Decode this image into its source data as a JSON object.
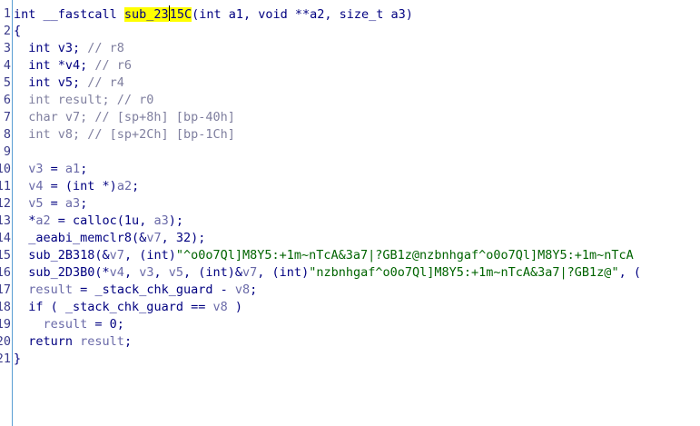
{
  "function_name": "sub_2315C",
  "lines": [
    {
      "num": "1",
      "tokens": [
        {
          "t": "int __fastcall ",
          "c": "plain"
        },
        {
          "t": "sub_23",
          "c": "hl"
        },
        {
          "caret": true
        },
        {
          "t": "15C",
          "c": "hl"
        },
        {
          "t": "(int a1, void **a2, size_t a3)",
          "c": "plain"
        }
      ]
    },
    {
      "num": "2",
      "tokens": [
        {
          "t": "{",
          "c": "plain"
        }
      ]
    },
    {
      "num": "3",
      "tokens": [
        {
          "t": "  int v3; ",
          "c": "plain"
        },
        {
          "t": "// r8",
          "c": "comment"
        }
      ]
    },
    {
      "num": "4",
      "tokens": [
        {
          "t": "  int *v4; ",
          "c": "plain"
        },
        {
          "t": "// r6",
          "c": "comment"
        }
      ]
    },
    {
      "num": "5",
      "tokens": [
        {
          "t": "  int v5; ",
          "c": "plain"
        },
        {
          "t": "// r4",
          "c": "comment"
        }
      ]
    },
    {
      "num": "6",
      "tokens": [
        {
          "t": "  int result; ",
          "c": "comment"
        },
        {
          "t": "// r0",
          "c": "comment"
        }
      ]
    },
    {
      "num": "7",
      "tokens": [
        {
          "t": "  char v7; ",
          "c": "comment"
        },
        {
          "t": "// [sp+8h] [bp-40h]",
          "c": "comment"
        }
      ]
    },
    {
      "num": "8",
      "tokens": [
        {
          "t": "  int v8; ",
          "c": "comment"
        },
        {
          "t": "// [sp+2Ch] [bp-1Ch]",
          "c": "comment"
        }
      ]
    },
    {
      "num": "9",
      "tokens": []
    },
    {
      "num": "10",
      "tokens": [
        {
          "t": "  ",
          "c": "plain"
        },
        {
          "t": "v3",
          "c": "var"
        },
        {
          "t": " = ",
          "c": "plain"
        },
        {
          "t": "a1",
          "c": "var"
        },
        {
          "t": ";",
          "c": "plain"
        }
      ]
    },
    {
      "num": "11",
      "tokens": [
        {
          "t": "  ",
          "c": "plain"
        },
        {
          "t": "v4",
          "c": "var"
        },
        {
          "t": " = (int *)",
          "c": "plain"
        },
        {
          "t": "a2",
          "c": "var"
        },
        {
          "t": ";",
          "c": "plain"
        }
      ]
    },
    {
      "num": "12",
      "tokens": [
        {
          "t": "  ",
          "c": "plain"
        },
        {
          "t": "v5",
          "c": "var"
        },
        {
          "t": " = ",
          "c": "plain"
        },
        {
          "t": "a3",
          "c": "var"
        },
        {
          "t": ";",
          "c": "plain"
        }
      ]
    },
    {
      "num": "13",
      "tokens": [
        {
          "t": "  *",
          "c": "plain"
        },
        {
          "t": "a2",
          "c": "var"
        },
        {
          "t": " = calloc(1u, ",
          "c": "plain"
        },
        {
          "t": "a3",
          "c": "var"
        },
        {
          "t": ");",
          "c": "plain"
        }
      ]
    },
    {
      "num": "14",
      "tokens": [
        {
          "t": "  _aeabi_memclr8(&",
          "c": "plain"
        },
        {
          "t": "v7",
          "c": "var"
        },
        {
          "t": ", 32);",
          "c": "plain"
        }
      ]
    },
    {
      "num": "15",
      "tokens": [
        {
          "t": "  sub_2B318(&",
          "c": "plain"
        },
        {
          "t": "v7",
          "c": "var"
        },
        {
          "t": ", (int)",
          "c": "plain"
        },
        {
          "t": "\"^o0o7Ql]M8Y5:+1m~nTcA&3a7|?GB1z@nzbnhgaf^o0o7Ql]M8Y5:+1m~nTcA",
          "c": "str"
        }
      ]
    },
    {
      "num": "16",
      "tokens": [
        {
          "t": "  sub_2D3B0(*",
          "c": "plain"
        },
        {
          "t": "v4",
          "c": "var"
        },
        {
          "t": ", ",
          "c": "plain"
        },
        {
          "t": "v3",
          "c": "var"
        },
        {
          "t": ", ",
          "c": "plain"
        },
        {
          "t": "v5",
          "c": "var"
        },
        {
          "t": ", (int)&",
          "c": "plain"
        },
        {
          "t": "v7",
          "c": "var"
        },
        {
          "t": ", (int)",
          "c": "plain"
        },
        {
          "t": "\"nzbnhgaf^o0o7Ql]M8Y5:+1m~nTcA&3a7|?GB1z@\"",
          "c": "str"
        },
        {
          "t": ", (",
          "c": "plain"
        }
      ]
    },
    {
      "num": "17",
      "tokens": [
        {
          "t": "  ",
          "c": "plain"
        },
        {
          "t": "result",
          "c": "var"
        },
        {
          "t": " = ",
          "c": "plain"
        },
        {
          "t": "_stack_chk_guard",
          "c": "func"
        },
        {
          "t": " - ",
          "c": "plain"
        },
        {
          "t": "v8",
          "c": "var"
        },
        {
          "t": ";",
          "c": "plain"
        }
      ]
    },
    {
      "num": "18",
      "tokens": [
        {
          "t": "  if ( ",
          "c": "plain"
        },
        {
          "t": "_stack_chk_guard",
          "c": "func"
        },
        {
          "t": " == ",
          "c": "plain"
        },
        {
          "t": "v8",
          "c": "var"
        },
        {
          "t": " )",
          "c": "plain"
        }
      ]
    },
    {
      "num": "19",
      "tokens": [
        {
          "t": "    ",
          "c": "plain"
        },
        {
          "t": "result",
          "c": "var"
        },
        {
          "t": " = 0;",
          "c": "plain"
        }
      ]
    },
    {
      "num": "20",
      "tokens": [
        {
          "t": "  return ",
          "c": "plain"
        },
        {
          "t": "result",
          "c": "var"
        },
        {
          "t": ";",
          "c": "plain"
        }
      ]
    },
    {
      "num": "21",
      "tokens": [
        {
          "t": "}",
          "c": "plain"
        }
      ]
    }
  ]
}
